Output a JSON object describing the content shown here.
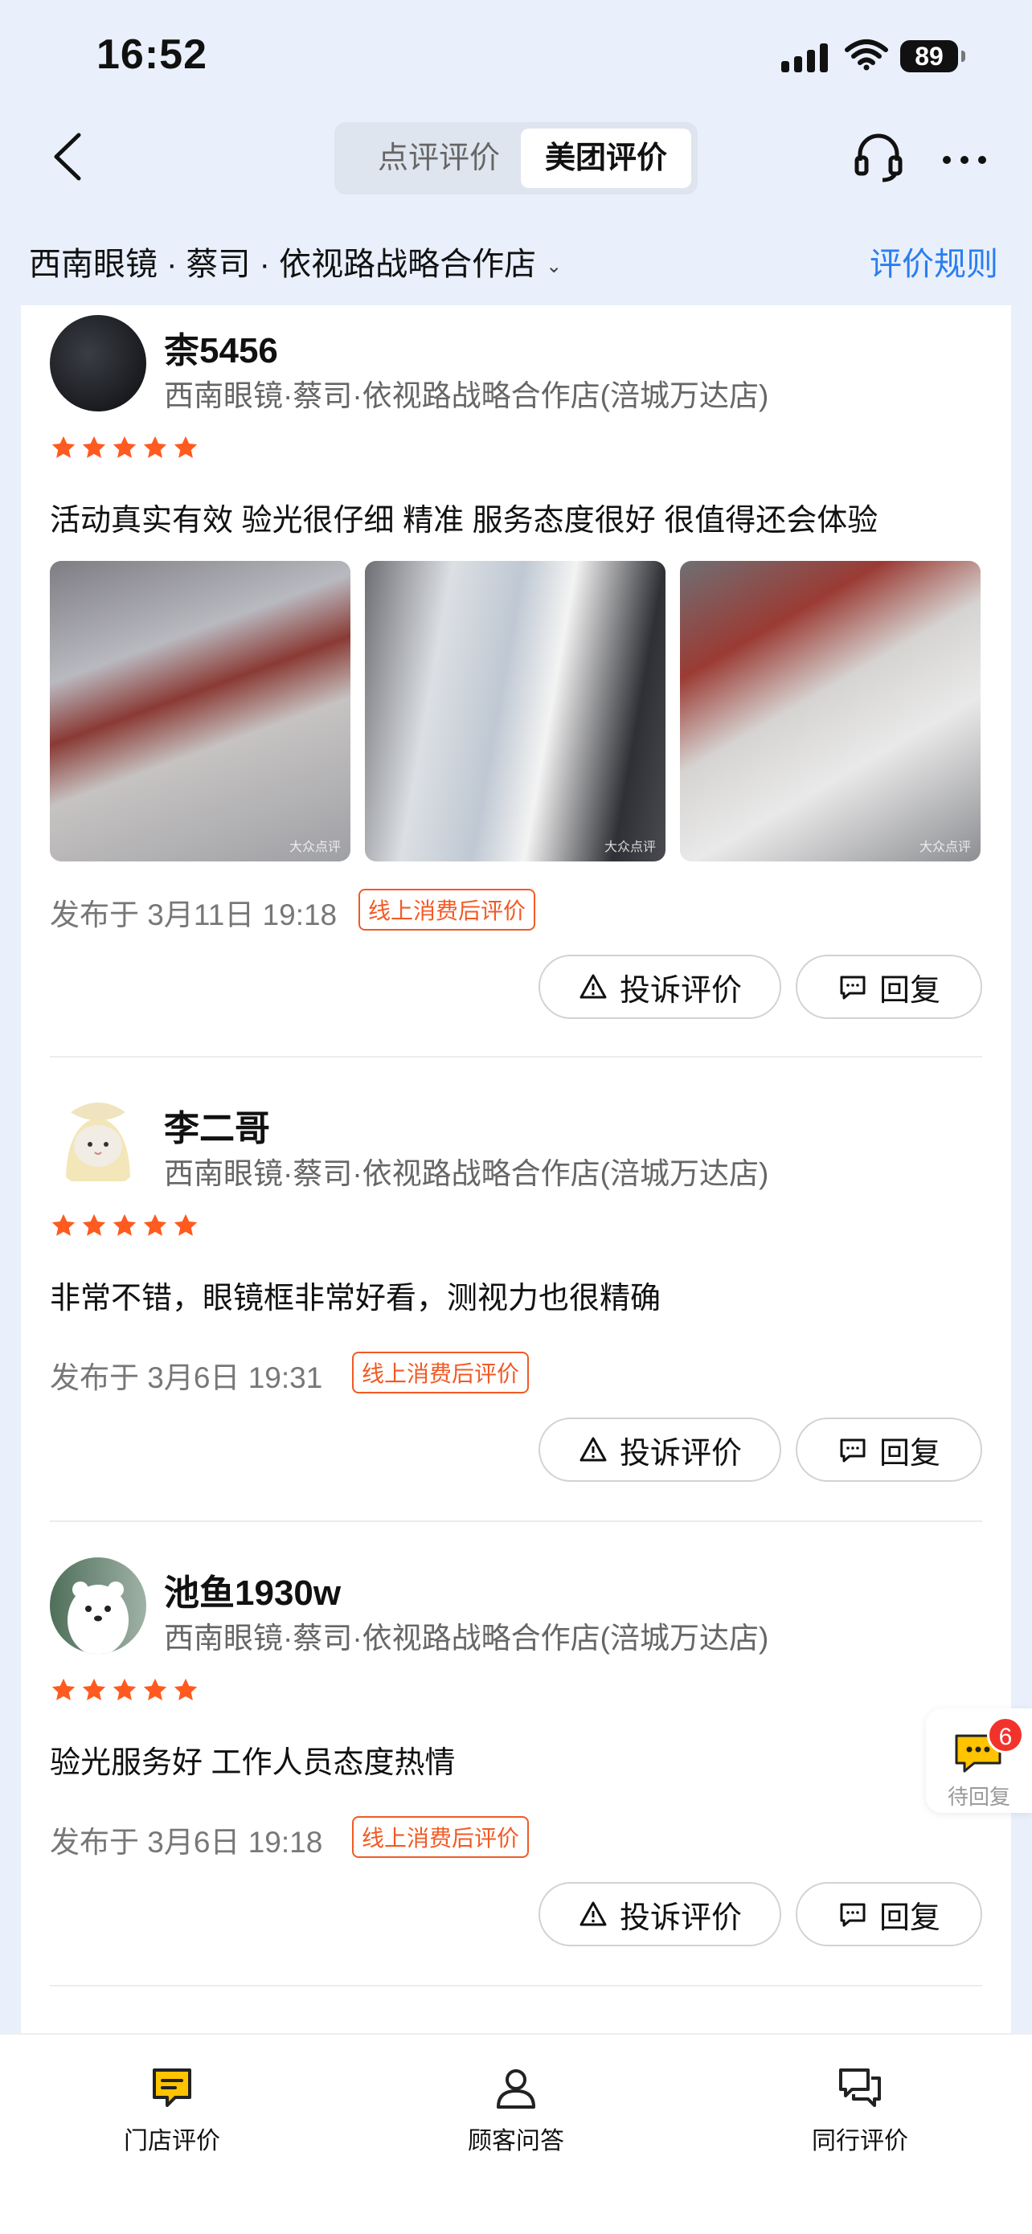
{
  "status_bar": {
    "time": "16:52",
    "battery": "89"
  },
  "nav": {
    "tabs": [
      {
        "label": "点评评价"
      },
      {
        "label": "美团评价"
      }
    ],
    "active_tab": "美团评价"
  },
  "store_header": {
    "name": "西南眼镜 · 蔡司 · 依视路战略合作店",
    "rules": "评价规则"
  },
  "reviews": [
    {
      "user": "柰5456",
      "shop": "西南眼镜·蔡司·依视路战略合作店(涪城万达店)",
      "stars": 5,
      "text": "活动真实有效 验光很仔细 精准 服务态度很好 很值得还会体验",
      "photos": [
        "store-interior",
        "display-shelves",
        "store-counter"
      ],
      "photo_watermark": "大众点评",
      "date": "发布于 3月11日 19:18",
      "tag": "线上消费后评价",
      "complain": "投诉评价",
      "reply": "回复"
    },
    {
      "user": "李二哥",
      "shop": "西南眼镜·蔡司·依视路战略合作店(涪城万达店)",
      "stars": 5,
      "text": "非常不错，眼镜框非常好看，测视力也很精确",
      "date": "发布于 3月6日 19:31",
      "tag": "线上消费后评价",
      "complain": "投诉评价",
      "reply": "回复"
    },
    {
      "user": "池鱼1930w",
      "shop": "西南眼镜·蔡司·依视路战略合作店(涪城万达店)",
      "stars": 5,
      "text": "验光服务好 工作人员态度热情",
      "date": "发布于 3月6日 19:18",
      "tag": "线上消费后评价",
      "complain": "投诉评价",
      "reply": "回复"
    }
  ],
  "pending": {
    "count": "6",
    "label": "待回复"
  },
  "tabbar": [
    {
      "label": "门店评价",
      "icon": "store-review-icon"
    },
    {
      "label": "顾客问答",
      "icon": "user-icon"
    },
    {
      "label": "同行评价",
      "icon": "chat-icon"
    }
  ],
  "colors": {
    "star": "#ff5a1f",
    "accent_blue": "#2a7ef0",
    "tag": "#f25a24",
    "badge": "#f2332c",
    "active_tab_icon": "#ffc300"
  }
}
